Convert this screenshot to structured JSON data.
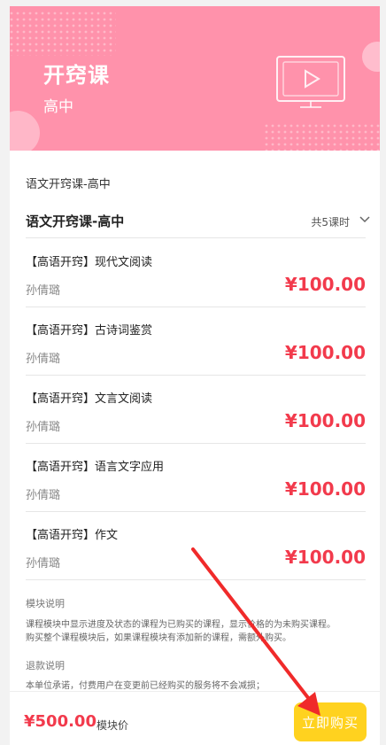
{
  "banner": {
    "title": "开窍课",
    "subtitle": "高中",
    "icon": "video-play-icon"
  },
  "section_label": "语文开窍课-高中",
  "module": {
    "title": "语文开窍课-高中",
    "count": "共5课时",
    "expand_icon": "chevron-down-icon"
  },
  "lessons": [
    {
      "title": "【高语开窍】现代文阅读",
      "teacher": "孙倩璐",
      "price": "¥100.00"
    },
    {
      "title": "【高语开窍】古诗词鉴赏",
      "teacher": "孙倩璐",
      "price": "¥100.00"
    },
    {
      "title": "【高语开窍】文言文阅读",
      "teacher": "孙倩璐",
      "price": "¥100.00"
    },
    {
      "title": "【高语开窍】语言文字应用",
      "teacher": "孙倩璐",
      "price": "¥100.00"
    },
    {
      "title": "【高语开窍】作文",
      "teacher": "孙倩璐",
      "price": "¥100.00"
    }
  ],
  "module_info": {
    "heading": "模块说明",
    "text_line1": "课程模块中显示进度及状态的课程为已购买的课程，显示价格的为未购买课程。",
    "text_line2": "购买整个课程模块后，如果课程模块有添加新的课程，需额外购买。"
  },
  "refund_info": {
    "heading": "退款说明",
    "text_line1": "本单位承诺，付费用户在变更前已经购买的服务将不会减损；"
  },
  "bottom_bar": {
    "total_price": "¥500.00",
    "total_label": "模块价",
    "buy_label": "立即购买"
  },
  "colors": {
    "banner": "#ff92ab",
    "price": "#f23a4c",
    "buy_button": "#ffd21f",
    "annotation_arrow": "#f02a2a"
  }
}
